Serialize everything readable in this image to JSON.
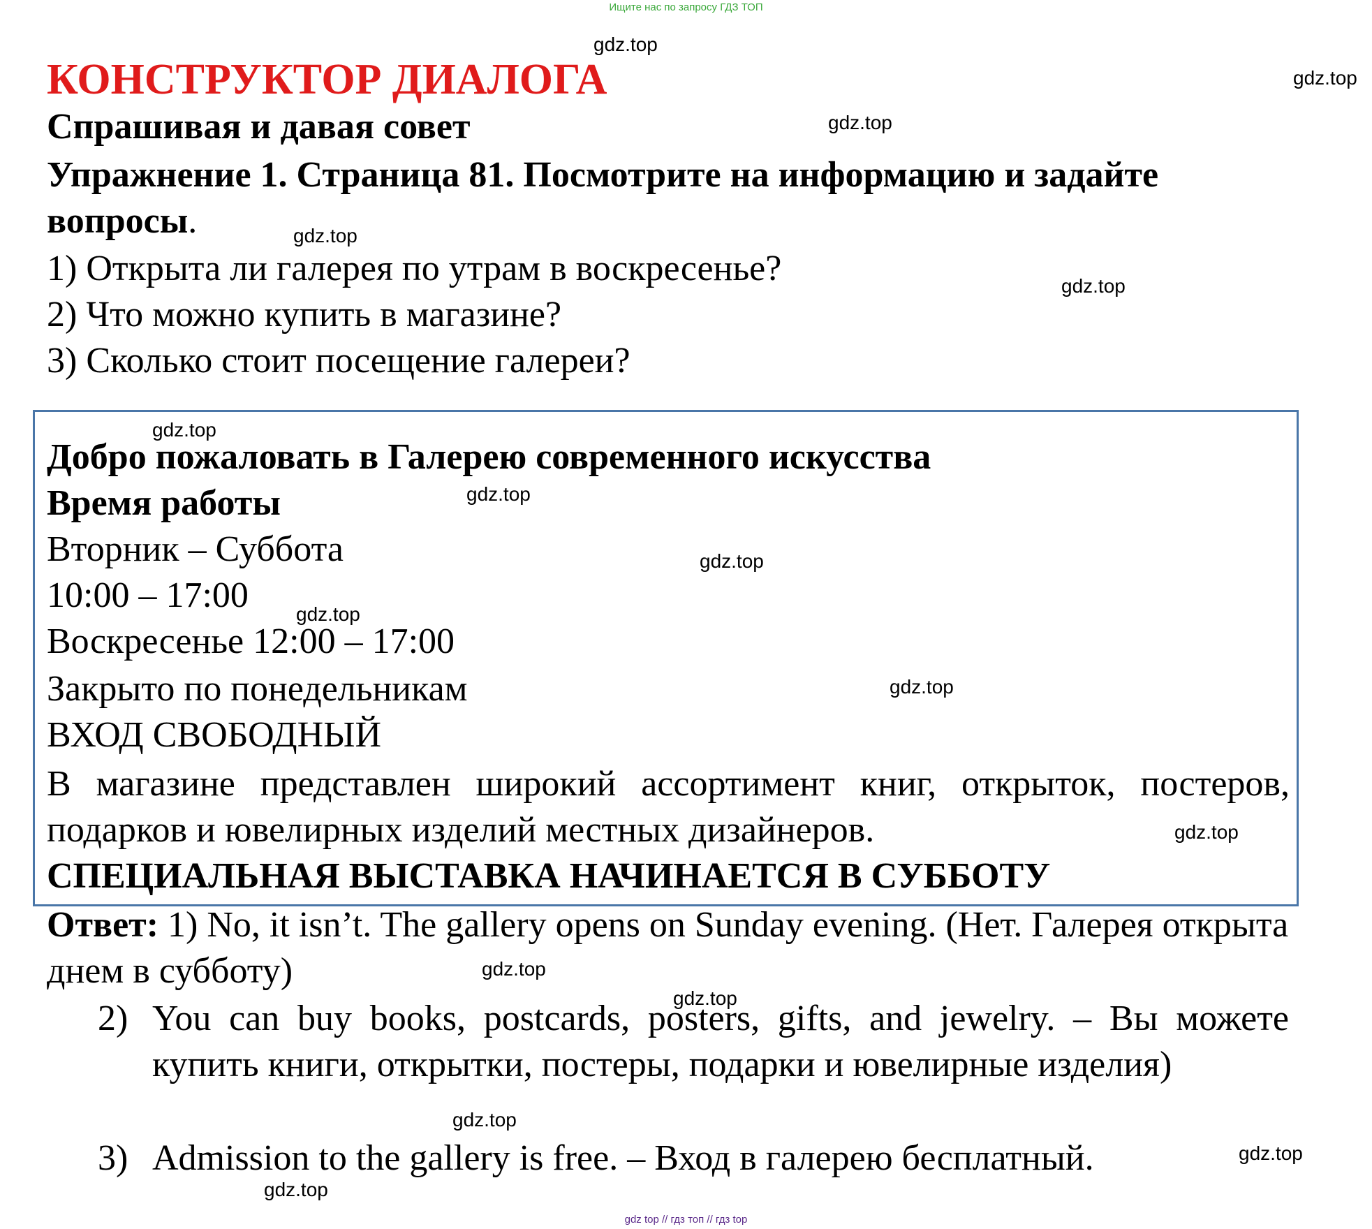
{
  "banners": {
    "top": "Ищите нас по запросу ГДЗ ТОП",
    "bottom": "gdz top  //  гдз топ  //  гдз top"
  },
  "header": {
    "title": "КОНСТРУКТОР ДИАЛОГА",
    "subtitle": "Спрашивая и давая совет",
    "exercise": "Упражнение 1. Страница 81. Посмотрите на информацию и задайте вопросы",
    "exercise_end": "."
  },
  "questions": [
    "1) Открыта ли галерея по утрам в воскресенье?",
    "2) Что можно купить в магазине?",
    "3) Сколько стоит посещение галереи?"
  ],
  "info_box": {
    "welcome": "Добро пожаловать в Галерею современного искусства",
    "hours_heading": "Время работы",
    "weekdays": "Вторник – Суббота",
    "weekday_hours": "10:00 – 17:00",
    "sunday": "Воскресенье 12:00 – 17:00",
    "closed": "Закрыто по понедельникам",
    "admission": "ВХОД СВОБОДНЫЙ",
    "shop": "В магазине представлен широкий ассортимент книг, открыток, постеров, подарков и ювелирных изделий местных дизайнеров.",
    "special": "СПЕЦИАЛЬНАЯ ВЫСТАВКА НАЧИНАЕТСЯ В СУББОТУ"
  },
  "answers": {
    "label": "Ответ:",
    "a1": " 1) No, it isn’t. The gallery opens on Sunday evening. (Нет. Галерея открыта днем в субботу)",
    "a2_num": "2)",
    "a2": "You can buy books, postcards, posters, gifts, and jewelry. – Вы можете купить книги, открытки, постеры, подарки и ювелирные изделия)",
    "a3_num": "3)",
    "a3": "Admission to the gallery is free. – Вход в галерею бесплатный."
  },
  "watermark": "gdz.top"
}
